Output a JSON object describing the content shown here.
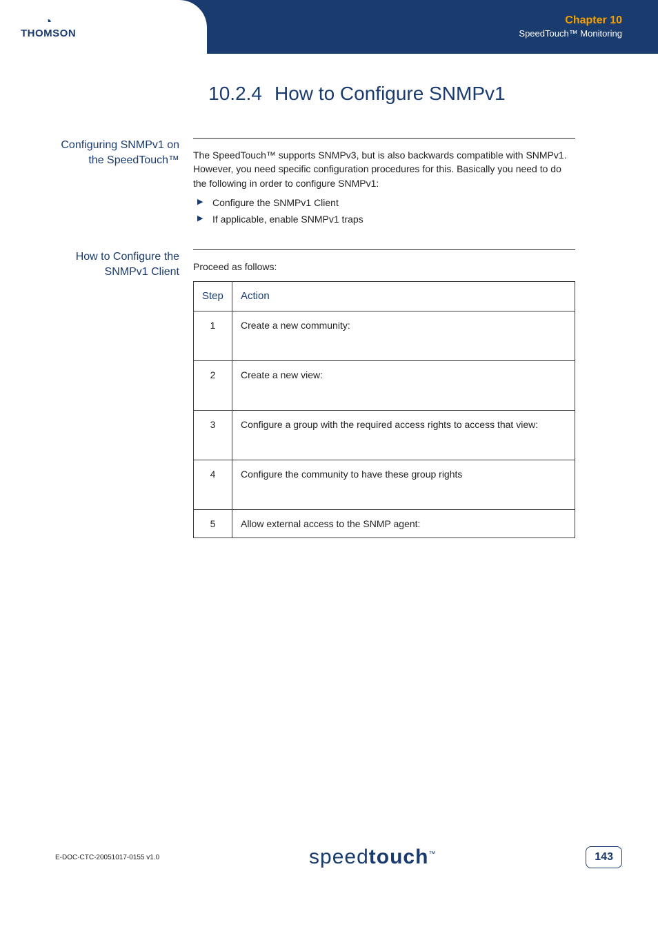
{
  "header": {
    "logo_text": "THOMSON",
    "chapter": "Chapter 10",
    "subtitle": "SpeedTouch™ Monitoring"
  },
  "heading": {
    "number": "10.2.4",
    "title": "How to Configure SNMPv1"
  },
  "section1": {
    "label": "Configuring SNMPv1 on the SpeedTouch™",
    "intro": "The SpeedTouch™ supports SNMPv3, but is also backwards compatible with SNMPv1. However, you need specific configuration procedures for this. Basically you need to do the following in order to configure SNMPv1:",
    "bullets": [
      "Configure the SNMPv1 Client",
      "If applicable, enable SNMPv1 traps"
    ]
  },
  "section2": {
    "label": "How to Configure the SNMPv1 Client",
    "lead": "Proceed as follows:",
    "table": {
      "col_step": "Step",
      "col_action": "Action",
      "rows": [
        {
          "step": "1",
          "action": "Create a new community:"
        },
        {
          "step": "2",
          "action": "Create a new view:"
        },
        {
          "step": "3",
          "action": "Configure a group with the required access rights to access that view:"
        },
        {
          "step": "4",
          "action": "Configure the community to have these group rights"
        },
        {
          "step": "5",
          "action": "Allow external access to the SNMP agent:"
        }
      ]
    }
  },
  "footer": {
    "docid": "E-DOC-CTC-20051017-0155 v1.0",
    "brand_light": "speed",
    "brand_bold": "touch",
    "brand_tm": "™",
    "page": "143"
  }
}
